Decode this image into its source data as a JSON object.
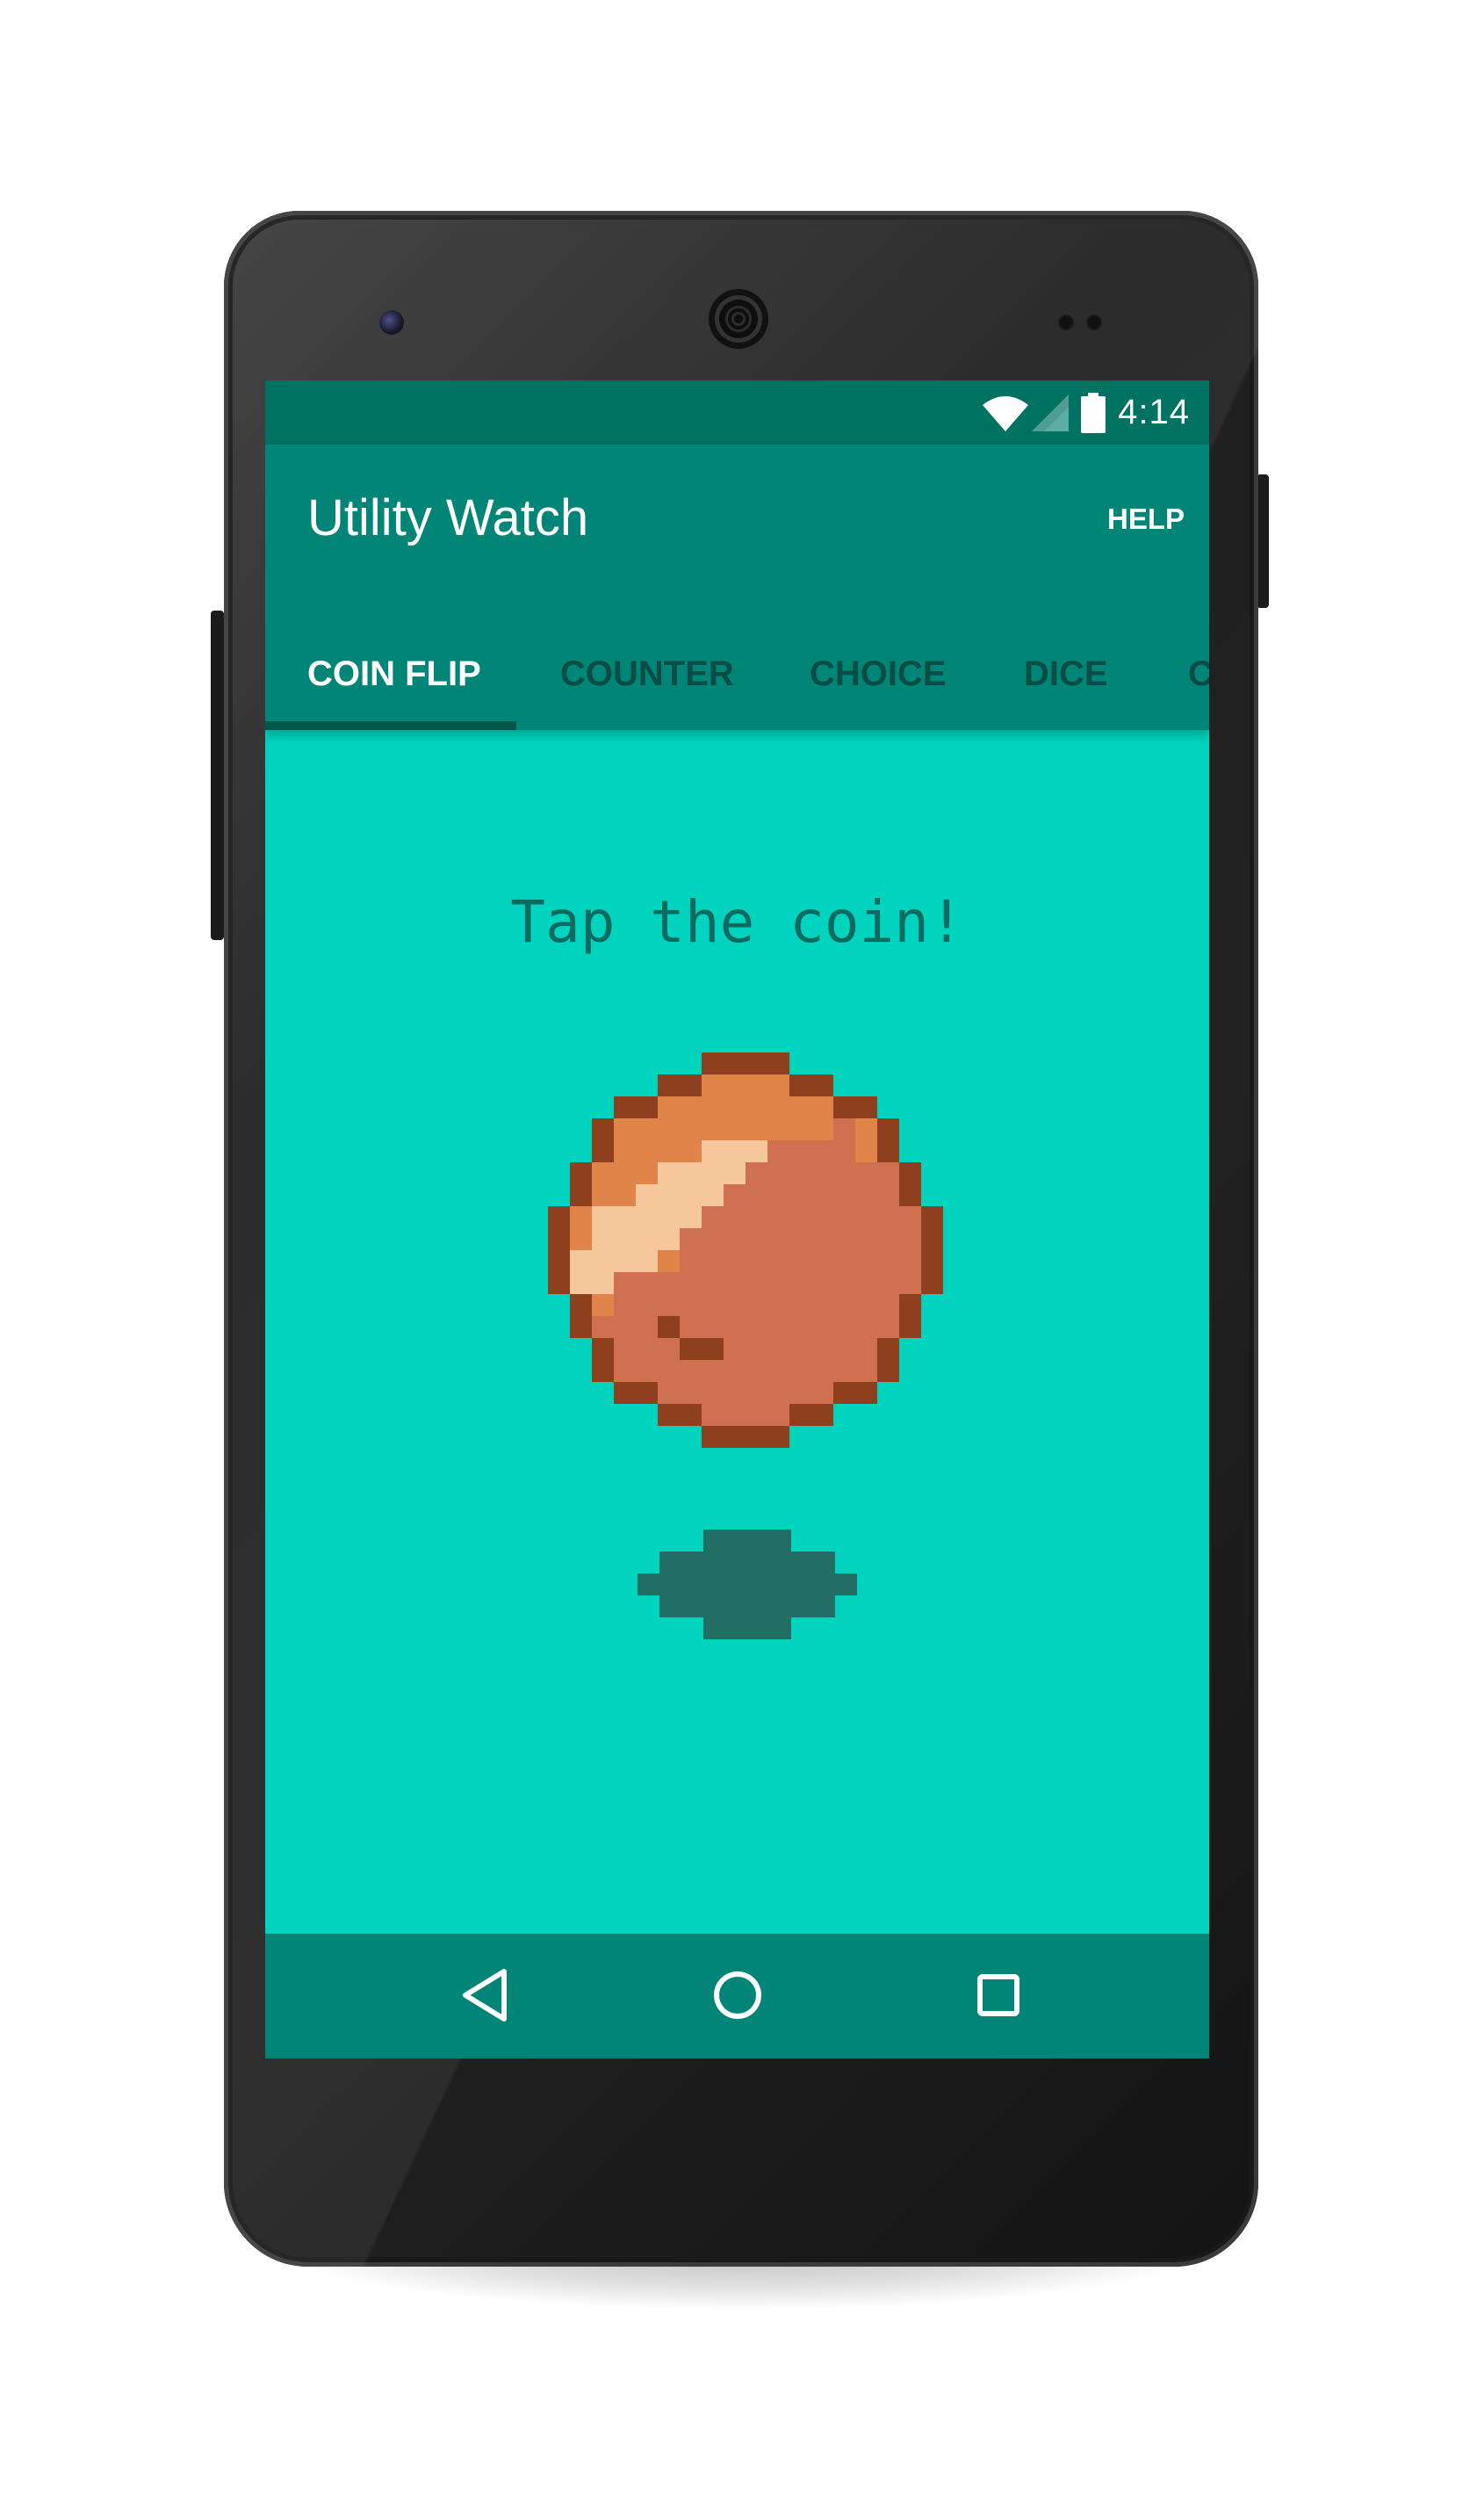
{
  "status_bar": {
    "time": "4:14"
  },
  "app_bar": {
    "title": "Utility Watch",
    "help_label": "HELP"
  },
  "tabs": [
    {
      "label": "COIN FLIP",
      "active": true
    },
    {
      "label": "COUNTER",
      "active": false
    },
    {
      "label": "CHOICE",
      "active": false
    },
    {
      "label": "DICE",
      "active": false
    },
    {
      "label": "C",
      "active": false
    }
  ],
  "main": {
    "headline": "Tap the coin!"
  },
  "icons": {
    "wifi": "wifi-icon",
    "signal": "cell-signal-icon",
    "battery": "battery-icon",
    "back": "back-icon",
    "home": "home-icon",
    "recents": "recents-icon",
    "coin": "coin-icon",
    "coin_shadow": "coin-shadow"
  },
  "colors": {
    "status_bar": "#007262",
    "app_bar": "#008576",
    "content_bg": "#00d4be",
    "tab_inactive": "#0a4d44",
    "headline": "#0b6b61",
    "coin_outline": "#8e3f1e",
    "coin_body": "#cf7150",
    "coin_rim": "#e0844a",
    "coin_highlight": "#f6c69c"
  }
}
